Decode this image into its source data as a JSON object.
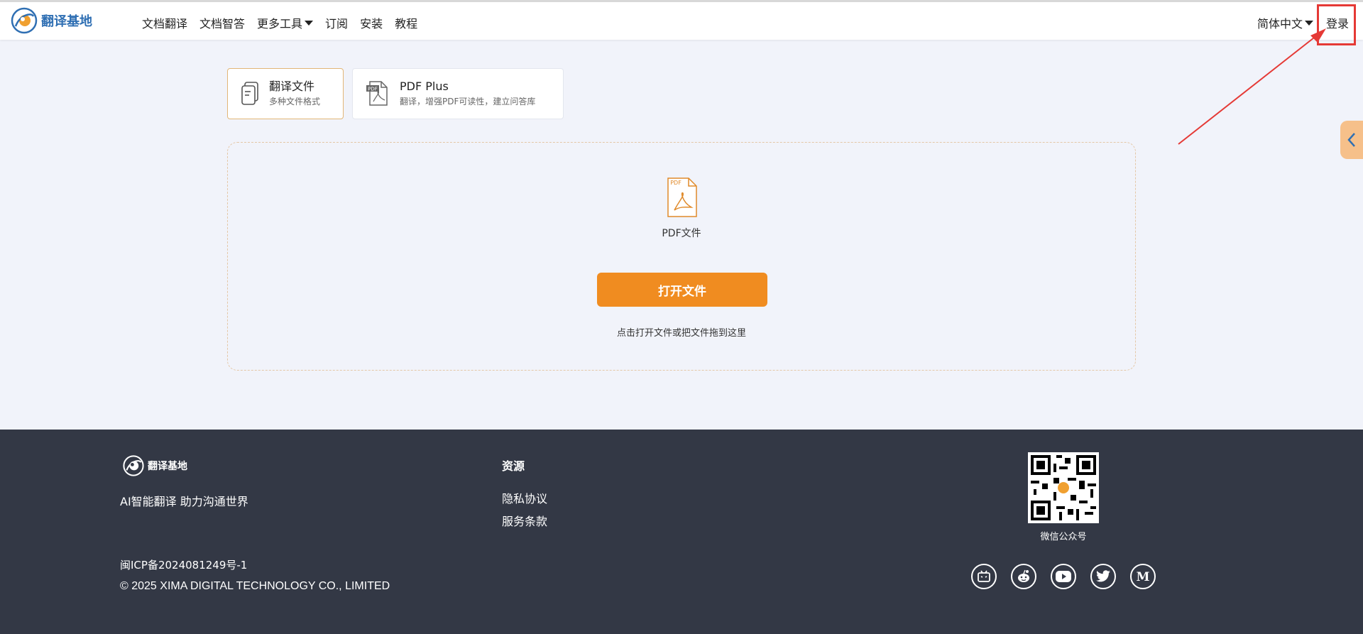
{
  "brand": {
    "name": "翻译基地"
  },
  "nav": {
    "items": [
      "文档翻译",
      "文档智答",
      "更多工具",
      "订阅",
      "安装",
      "教程"
    ],
    "language": "简体中文",
    "login": "登录"
  },
  "modes": [
    {
      "title": "翻译文件",
      "subtitle": "多种文件格式"
    },
    {
      "title": "PDF Plus",
      "subtitle": "翻译，增强PDF可读性，建立问答库"
    }
  ],
  "dropzone": {
    "file_type_label": "PDF文件",
    "open_button": "打开文件",
    "hint": "点击打开文件或把文件拖到这里"
  },
  "footer": {
    "brand": "翻译基地",
    "slogan": "AI智能翻译 助力沟通世界",
    "resources_title": "资源",
    "links": [
      "隐私协议",
      "服务条款"
    ],
    "icp": "闽ICP备2024081249号-1",
    "copyright": "© 2025 XIMA DIGITAL TECHNOLOGY CO., LIMITED",
    "qr_label": "微信公众号",
    "social": [
      "bilibili-icon",
      "reddit-icon",
      "youtube-icon",
      "twitter-icon",
      "medium-icon"
    ]
  },
  "colors": {
    "accent": "#f08c20",
    "brand_blue": "#2f6fb3",
    "footer_bg": "#333845",
    "highlight": "#e53935"
  }
}
